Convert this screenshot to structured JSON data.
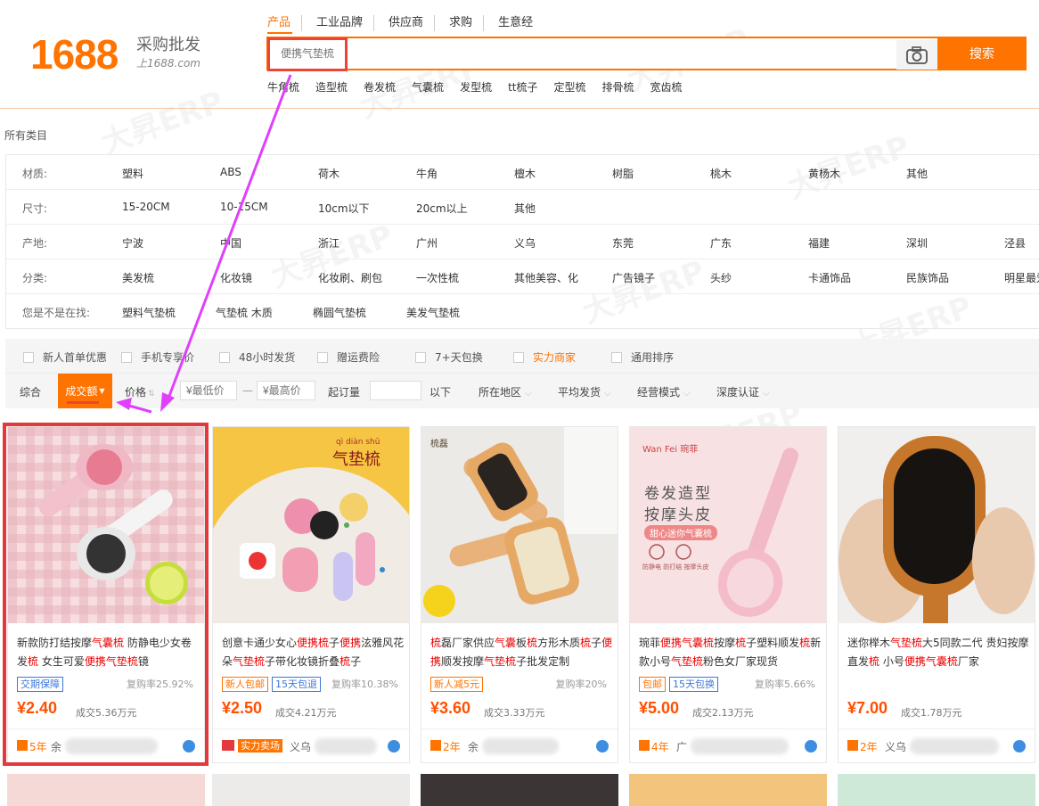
{
  "header": {
    "logo_number": "1688",
    "logo_text": "采购批发",
    "logo_url": "上1688.com",
    "nav_tabs": [
      "产品",
      "工业品牌",
      "供应商",
      "求购",
      "生意经"
    ],
    "search": {
      "placeholder": "便携气垫梳",
      "button_label": "搜索"
    },
    "hot_words": [
      "牛角梳",
      "造型梳",
      "卷发梳",
      "气囊梳",
      "发型梳",
      "tt梳子",
      "定型梳",
      "排骨梳",
      "宽齿梳"
    ]
  },
  "category": {
    "all_label": "所有类目"
  },
  "filters": [
    {
      "label": "材质:",
      "values": [
        "塑料",
        "ABS",
        "荷木",
        "牛角",
        "檀木",
        "树脂",
        "桃木",
        "黄杨木",
        "其他"
      ]
    },
    {
      "label": "尺寸:",
      "values": [
        "15-20CM",
        "10-15CM",
        "10cm以下",
        "20cm以上",
        "其他"
      ]
    },
    {
      "label": "产地:",
      "values": [
        "宁波",
        "中国",
        "浙江",
        "广州",
        "义乌",
        "东莞",
        "广东",
        "福建",
        "深圳",
        "泾县"
      ]
    },
    {
      "label": "分类:",
      "values": [
        "美发梳",
        "化妆镜",
        "化妆刷、刷包",
        "一次性梳",
        "其他美容、化",
        "广告镜子",
        "头纱",
        "卡通饰品",
        "民族饰品",
        "明星最爱"
      ]
    },
    {
      "label": "您是不是在找:",
      "values": [
        "塑料气垫梳",
        "气垫梳 木质",
        "椭圆气垫梳",
        "美发气垫梳"
      ]
    }
  ],
  "checkbox_filters": [
    "新人首单优惠",
    "手机专享价",
    "48小时发货",
    "赠运费险",
    "7+天包换",
    "实力商家",
    "通用排序"
  ],
  "sort_bar": {
    "items": [
      "综合",
      "成交额",
      "价格",
      "起订量",
      "以下",
      "所在地区",
      "平均发货",
      "经营模式",
      "深度认证"
    ],
    "min_price_placeholder": "¥最低价",
    "max_price_placeholder": "¥最高价",
    "dash": "—"
  },
  "products": [
    {
      "title": "新款防打结按摩气囊梳 防静电少女卷发梳 女生可爱便携气垫梳镜",
      "tags": [
        "交期保障"
      ],
      "rate": "复购率25.92%",
      "price": "¥2.40",
      "deal": "成交5.36万元",
      "years": "5年",
      "shop": "余"
    },
    {
      "title": "创意卡通少女心便携梳子便携泫雅风花朵气垫梳子带化妆镜折叠梳子",
      "tags": [
        "新人包邮",
        "15天包退"
      ],
      "rate": "复购率10.38%",
      "price": "¥2.50",
      "deal": "成交4.21万元",
      "years": "实力卖场",
      "shop": "义乌"
    },
    {
      "title": "梳磊厂家供应气囊板梳方形木质梳子便携顺发按摩气垫梳子批发定制",
      "tags": [
        "新人减5元"
      ],
      "rate": "复购率20%",
      "price": "¥3.60",
      "deal": "成交3.33万元",
      "years": "2年",
      "shop": "余"
    },
    {
      "title": "琬菲便携气囊梳按摩梳子塑料顺发梳新款小号气垫梳粉色女厂家现货",
      "tags": [
        "包邮",
        "15天包换"
      ],
      "rate": "复购率5.66%",
      "price": "¥5.00",
      "deal": "成交2.13万元",
      "years": "4年",
      "shop": "广"
    },
    {
      "title": "迷你榉木气垫梳大5同款二代 贵妇按摩直发梳 小号便携气囊梳厂家",
      "tags": [],
      "rate": "",
      "price": "¥7.00",
      "deal": "成交1.78万元",
      "years": "2年",
      "shop": "义乌"
    }
  ],
  "image_text": {
    "card2_banner": "气垫梳",
    "card2_pinyin": "qì diàn shū",
    "card3_brand": "梳磊",
    "card4_brand": "Wan Fei 琬菲",
    "card4_heading1": "卷发造型",
    "card4_heading2": "按摩头皮",
    "card4_sub": "甜心迷你气囊梳",
    "card4_caption": "防静电 防打结 按摩头皮"
  },
  "colors": {
    "brand": "#ff7300",
    "price": "#ff5000",
    "highlight": "#e4393c",
    "annotation": "#e040fb"
  }
}
